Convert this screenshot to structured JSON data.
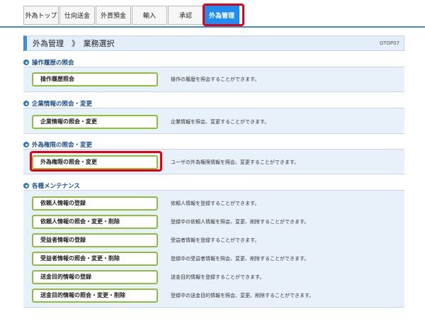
{
  "tabs": [
    {
      "label": "外為トップ"
    },
    {
      "label": "仕向送金"
    },
    {
      "label": "外貨預金"
    },
    {
      "label": "輸入"
    },
    {
      "label": "承認"
    },
    {
      "label": "外為管理",
      "active": true
    }
  ],
  "page": {
    "title": "外為管理　》　業務選択",
    "code": "GTOP07"
  },
  "sections": [
    {
      "label": "操作履歴の照会",
      "items": [
        {
          "button": "操作履歴照会",
          "description": "操作の履歴を照会することができます。"
        }
      ]
    },
    {
      "label": "企業情報の照会・変更",
      "items": [
        {
          "button": "企業情報の照会・変更",
          "description": "企業情報を照会、変更することができます。"
        }
      ]
    },
    {
      "label": "外為権限の照会・変更",
      "items": [
        {
          "button": "外為権限の照会・変更",
          "description": "ユーザの外為権限情報を照会、変更することができます。"
        }
      ]
    },
    {
      "label": "各種メンテナンス",
      "items": [
        {
          "button": "依頼人情報の登録",
          "description": "依頼人情報を登録することができます。"
        },
        {
          "button": "依頼人情報の照会・変更・削除",
          "description": "登録中の依頼人情報を照会、変更、削除することができます。"
        },
        {
          "button": "受益者情報の登録",
          "description": "受益者情報を登録することができます。"
        },
        {
          "button": "受益者情報の照会・変更・削除",
          "description": "登録中の受益者情報を照会、変更、削除することができます。"
        },
        {
          "button": "送金目的情報の登録",
          "description": "送金目的情報を登録することができます。"
        },
        {
          "button": "送金目的情報の照会・変更・削除",
          "description": "登録中の送金目的情報を照会、変更、削除することができます。"
        }
      ]
    }
  ],
  "colors": {
    "accent": "#1f8cf0",
    "highlight": "#e30014",
    "button_border": "#8dbf3a",
    "panel_bg": "#e8f1fa"
  }
}
